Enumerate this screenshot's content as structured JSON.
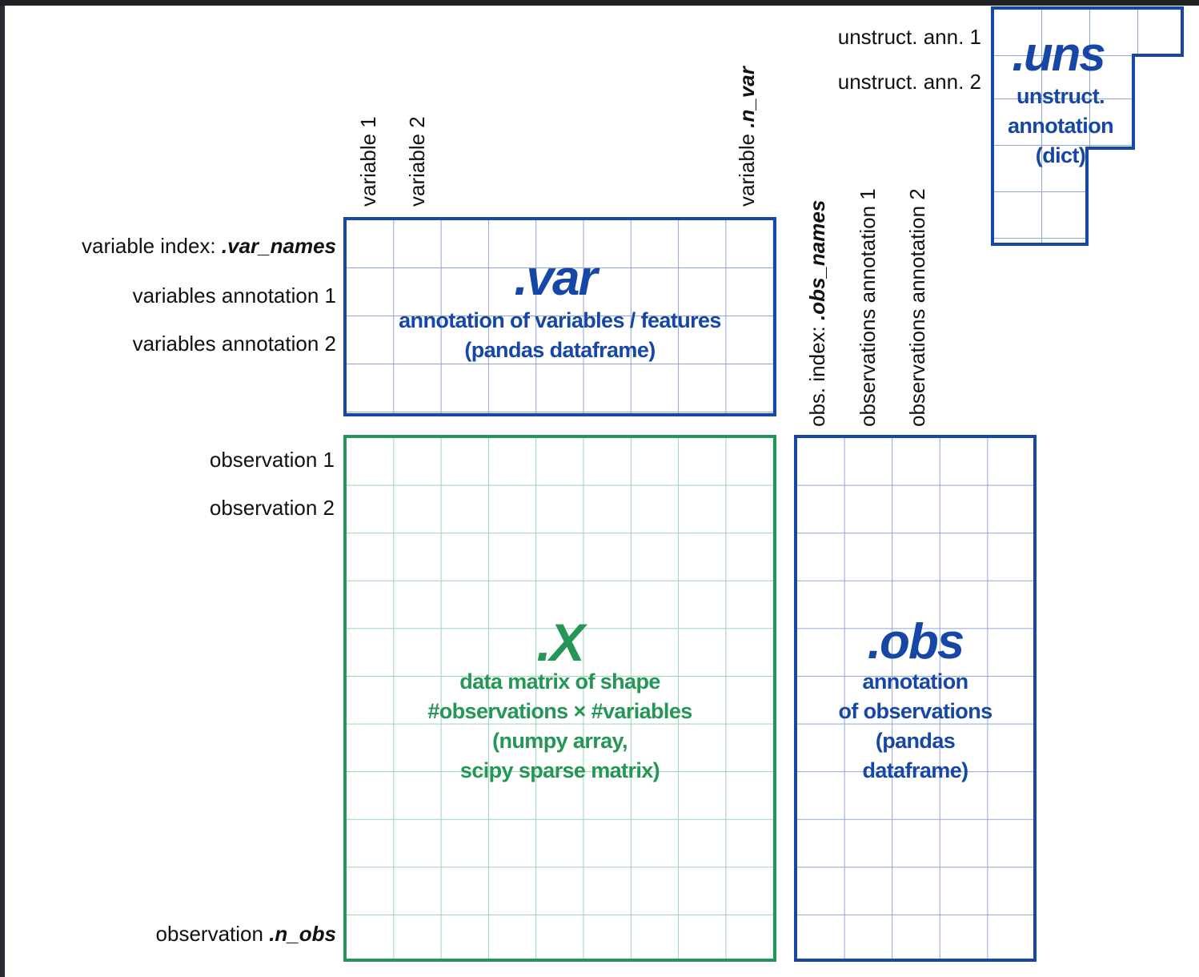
{
  "var_rows": [
    {
      "plain": "variable index: ",
      "code": ".var_names"
    },
    {
      "plain": "variables annotation 1",
      "code": ""
    },
    {
      "plain": "variables annotation 2",
      "code": ""
    }
  ],
  "var_cols": [
    {
      "plain": "variable 1",
      "code": ""
    },
    {
      "plain": "variable 2",
      "code": ""
    },
    {
      "plain": "variable ",
      "code": ".n_var"
    }
  ],
  "obs_rows": [
    {
      "plain": "observation 1",
      "code": ""
    },
    {
      "plain": "observation 2",
      "code": ""
    },
    {
      "plain": "observation ",
      "code": ".n_obs"
    }
  ],
  "obs_cols": [
    {
      "plain": "obs. index: ",
      "code": ".obs_names"
    },
    {
      "plain": "observations annotation 1",
      "code": ""
    },
    {
      "plain": "observations annotation 2",
      "code": ""
    }
  ],
  "uns_rows": [
    {
      "plain": "unstruct. ann. 1",
      "code": ""
    },
    {
      "plain": "unstruct. ann. 2",
      "code": ""
    }
  ],
  "blocks": {
    "var": {
      "title": ".var",
      "subtitle": "annotation of variables / features\n(pandas dataframe)"
    },
    "X": {
      "title": ".X",
      "subtitle": "data matrix of shape\n#observations × #variables\n(numpy array,\nscipy sparse matrix)"
    },
    "obs": {
      "title": ".obs",
      "subtitle": "annotation\nof observations\n(pandas\ndataframe)"
    },
    "uns": {
      "title": ".uns",
      "subtitle": "unstruct.\nannotation\n(dict)"
    }
  },
  "colors": {
    "blue": "#1747a6",
    "green": "#249655"
  }
}
